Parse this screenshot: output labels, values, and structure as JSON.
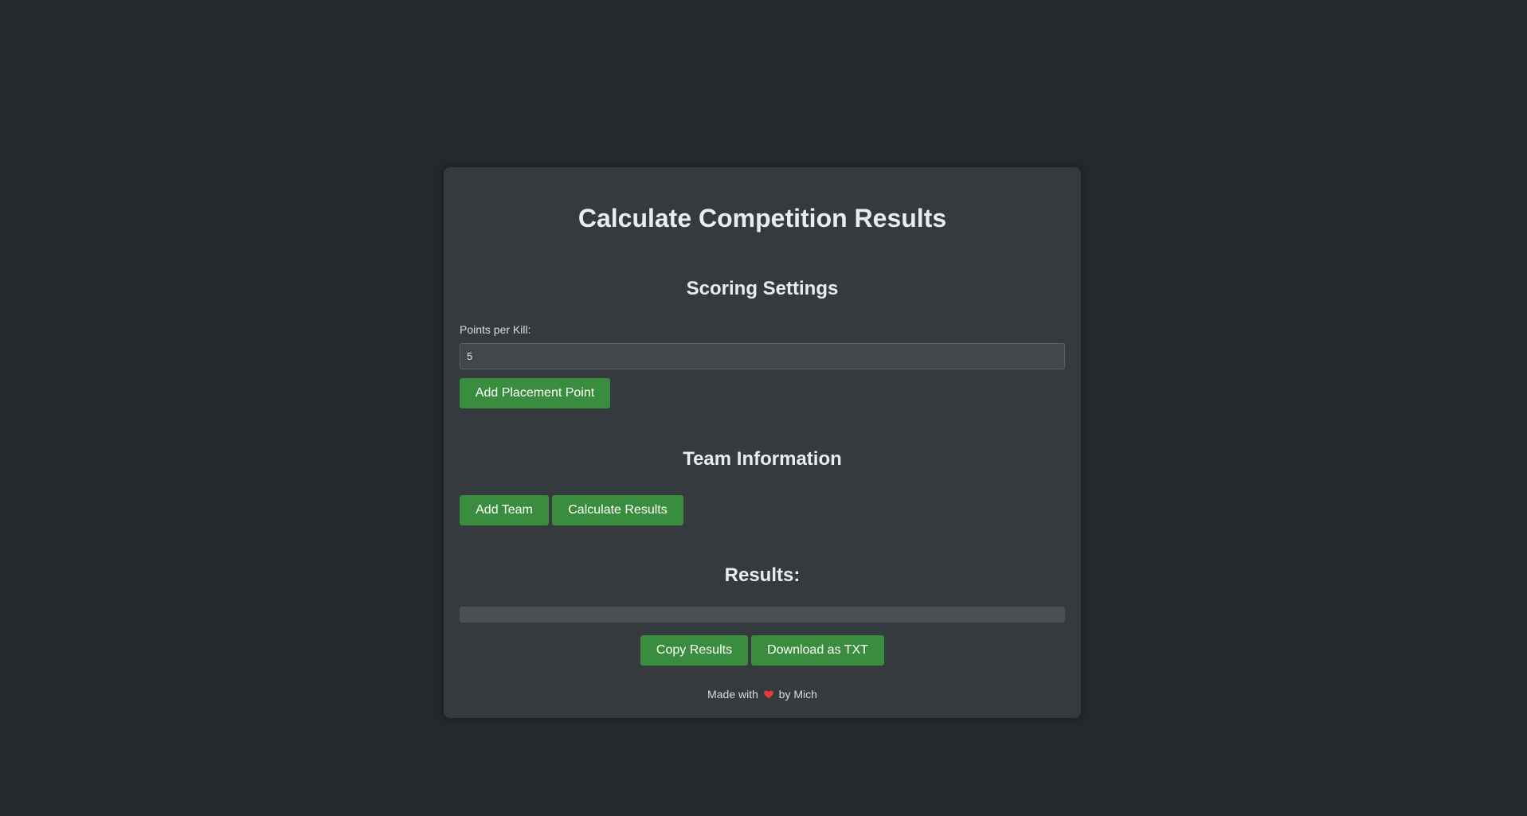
{
  "title": "Calculate Competition Results",
  "scoring": {
    "heading": "Scoring Settings",
    "points_label": "Points per Kill:",
    "points_value": "5",
    "add_placement_label": "Add Placement Point"
  },
  "team": {
    "heading": "Team Information",
    "add_team_label": "Add Team",
    "calculate_label": "Calculate Results"
  },
  "results": {
    "heading": "Results:",
    "content": "",
    "copy_label": "Copy Results",
    "download_label": "Download as TXT"
  },
  "footer": {
    "prefix": "Made with",
    "icon": "heart-icon",
    "suffix": "by Mich"
  },
  "colors": {
    "background": "#25292b",
    "card": "#343a3e",
    "button": "#3a8d3e",
    "heart": "#e53935"
  }
}
